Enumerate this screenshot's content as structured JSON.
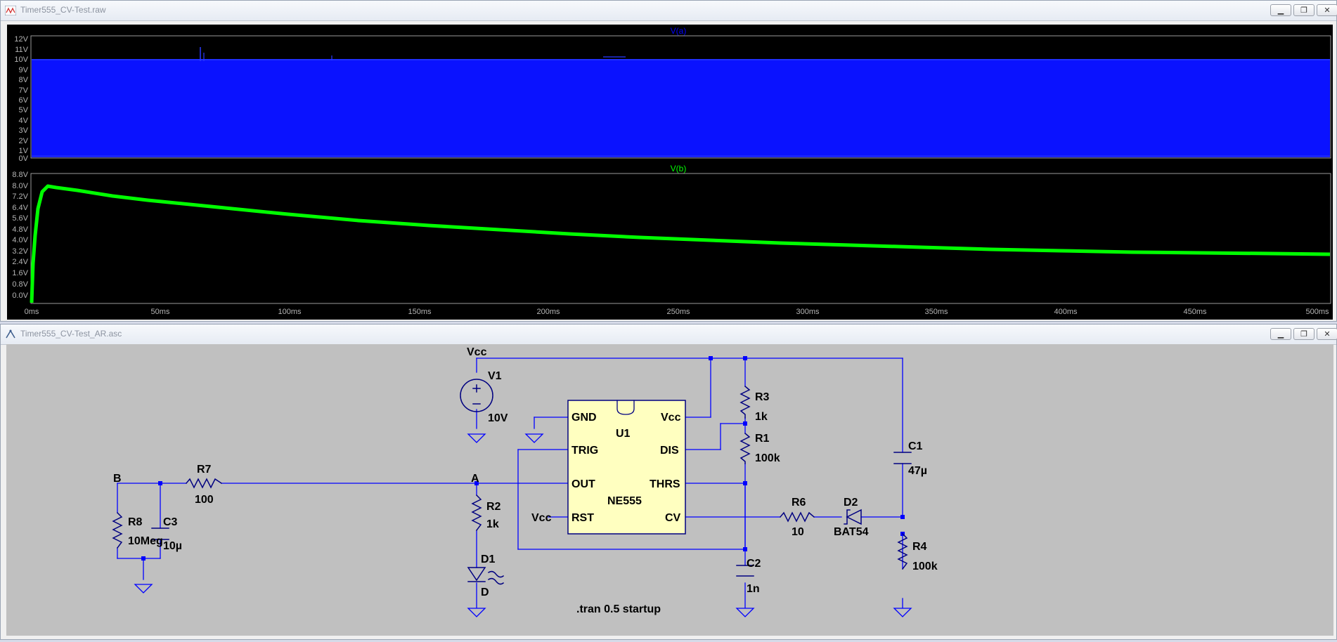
{
  "waveform_window": {
    "title": "Timer555_CV-Test.raw",
    "buttons": {
      "minimize": "▁",
      "restore": "❐",
      "close": "✕"
    },
    "pane_a": {
      "trace_name": "V(a)",
      "color": "#0000ff",
      "ticks": [
        "12V",
        "11V",
        "10V",
        "9V",
        "8V",
        "7V",
        "6V",
        "5V",
        "4V",
        "3V",
        "2V",
        "1V",
        "0V"
      ]
    },
    "pane_b": {
      "trace_name": "V(b)",
      "color": "#00ff00",
      "ticks": [
        "8.8V",
        "8.0V",
        "7.2V",
        "6.4V",
        "5.6V",
        "4.8V",
        "4.0V",
        "3.2V",
        "2.4V",
        "1.6V",
        "0.8V",
        "0.0V"
      ]
    },
    "x_ticks": [
      "0ms",
      "50ms",
      "100ms",
      "150ms",
      "200ms",
      "250ms",
      "300ms",
      "350ms",
      "400ms",
      "450ms",
      "500ms"
    ]
  },
  "schematic_window": {
    "title": "Timer555_CV-Test_AR.asc",
    "buttons": {
      "minimize": "▁",
      "restore": "❐",
      "close": "✕"
    },
    "labels": {
      "vcc_top": "Vcc",
      "v1": "V1",
      "v1_val": "10V",
      "u1": "U1",
      "u1_part": "NE555",
      "pin_gnd": "GND",
      "pin_vcc": "Vcc",
      "pin_trig": "TRIG",
      "pin_dis": "DIS",
      "pin_out": "OUT",
      "pin_thrs": "THRS",
      "pin_rst": "RST",
      "pin_cv": "CV",
      "vcc_rst": "Vcc",
      "r3": "R3",
      "r3_val": "1k",
      "r1": "R1",
      "r1_val": "100k",
      "c1": "C1",
      "c1_val": "47µ",
      "r6": "R6",
      "r6_val": "10",
      "d2": "D2",
      "d2_val": "BAT54",
      "r4": "R4",
      "r4_val": "100k",
      "c2": "C2",
      "c2_val": "1n",
      "node_a": "A",
      "node_b": "B",
      "r7": "R7",
      "r7_val": "100",
      "r8": "R8",
      "r8_val": "10Meg",
      "c3": "C3",
      "c3_val": "10µ",
      "r2": "R2",
      "r2_val": "1k",
      "d1": "D1",
      "d1_val": "D",
      "directive": ".tran 0.5 startup"
    }
  }
}
